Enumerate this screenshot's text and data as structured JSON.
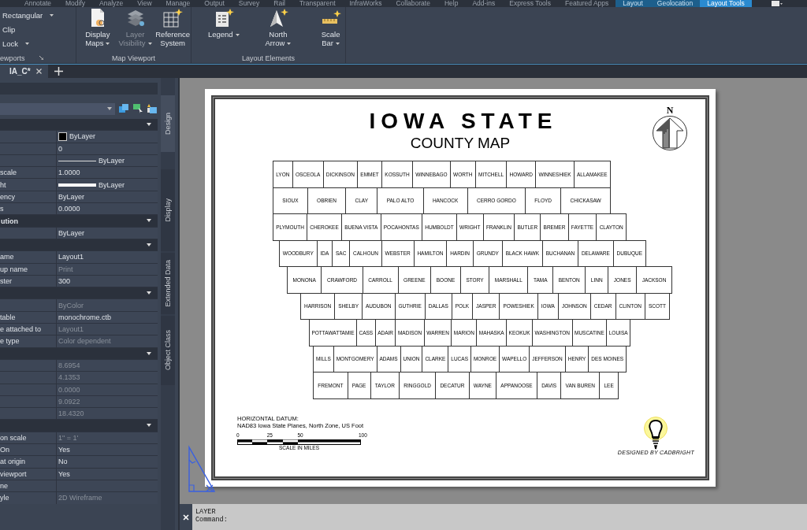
{
  "menu_tabs": [
    {
      "label": "Annotate",
      "kind": "normal",
      "selected": false
    },
    {
      "label": "Modify",
      "kind": "normal",
      "selected": false
    },
    {
      "label": "Analyze",
      "kind": "normal",
      "selected": false
    },
    {
      "label": "View",
      "kind": "normal",
      "selected": false
    },
    {
      "label": "Manage",
      "kind": "normal",
      "selected": false
    },
    {
      "label": "Output",
      "kind": "normal",
      "selected": false
    },
    {
      "label": "Survey",
      "kind": "normal",
      "selected": false
    },
    {
      "label": "Rail",
      "kind": "normal",
      "selected": false
    },
    {
      "label": "Transparent",
      "kind": "normal",
      "selected": false
    },
    {
      "label": "InfraWorks",
      "kind": "normal",
      "selected": false
    },
    {
      "label": "Collaborate",
      "kind": "normal",
      "selected": false
    },
    {
      "label": "Help",
      "kind": "normal",
      "selected": false
    },
    {
      "label": "Add-ins",
      "kind": "normal",
      "selected": false
    },
    {
      "label": "Express Tools",
      "kind": "normal",
      "selected": false
    },
    {
      "label": "Featured Apps",
      "kind": "normal",
      "selected": false
    },
    {
      "label": "Layout",
      "kind": "contextual",
      "selected": false
    },
    {
      "label": "Geolocation",
      "kind": "contextual",
      "selected": false
    },
    {
      "label": "Layout Tools",
      "kind": "contextual",
      "selected": true
    }
  ],
  "ribbon_panels": [
    {
      "title": "ewports",
      "kind": "list",
      "launcher": true,
      "items": [
        {
          "label": "Rectangular",
          "dropdown": true
        },
        {
          "label": "Clip",
          "dropdown": false
        },
        {
          "label": "Lock",
          "dropdown": true
        }
      ]
    },
    {
      "title": "Map Viewport",
      "kind": "large",
      "launcher": false,
      "items": [
        {
          "label": "Display Maps",
          "dropdown": true,
          "disabled": false
        },
        {
          "label": "Layer Visibility",
          "dropdown": true,
          "disabled": true
        },
        {
          "label": "Reference System",
          "dropdown": false,
          "disabled": false
        }
      ]
    },
    {
      "title": "Layout Elements",
      "kind": "large",
      "launcher": false,
      "items": [
        {
          "label": "Legend",
          "dropdown": true,
          "disabled": false
        },
        {
          "label": "North Arrow",
          "dropdown": true,
          "disabled": false
        },
        {
          "label": "Scale Bar",
          "dropdown": true,
          "disabled": false
        }
      ]
    }
  ],
  "file_tabs": [
    {
      "label": "IA_C*",
      "selected": true
    }
  ],
  "properties": [
    {
      "kind": "header"
    },
    {
      "kind": "swatch",
      "value": "ByLayer",
      "disabled": false
    },
    {
      "kind": "row",
      "value": "0",
      "disabled": false
    },
    {
      "kind": "linetype",
      "value": "ByLayer",
      "disabled": false
    },
    {
      "kind": "row",
      "label": "scale",
      "value": "1.0000",
      "disabled": false
    },
    {
      "kind": "lineweight",
      "label": "ht",
      "value": "ByLayer",
      "disabled": false
    },
    {
      "kind": "row",
      "label": "ency",
      "value": "ByLayer",
      "disabled": false
    },
    {
      "kind": "row",
      "label": "s",
      "value": "0.0000",
      "disabled": false
    },
    {
      "kind": "header",
      "title": "ution"
    },
    {
      "kind": "row",
      "value": "ByLayer",
      "disabled": false
    },
    {
      "kind": "header"
    },
    {
      "kind": "row",
      "label": "ame",
      "value": "Layout1",
      "disabled": false
    },
    {
      "kind": "row",
      "label": "up name",
      "value": "Print",
      "disabled": true
    },
    {
      "kind": "row",
      "label": "ster",
      "value": "300",
      "disabled": false
    },
    {
      "kind": "header"
    },
    {
      "kind": "row",
      "value": "ByColor",
      "disabled": true
    },
    {
      "kind": "row",
      "label": "table",
      "value": "monochrome.ctb",
      "disabled": false
    },
    {
      "kind": "row",
      "label": "e attached to",
      "value": "Layout1",
      "disabled": true
    },
    {
      "kind": "row",
      "label": "e type",
      "value": "Color dependent",
      "disabled": true
    },
    {
      "kind": "header"
    },
    {
      "kind": "row",
      "value": "8.6954",
      "disabled": true
    },
    {
      "kind": "row",
      "value": "4.1353",
      "disabled": true
    },
    {
      "kind": "row",
      "value": "0.0000",
      "disabled": true
    },
    {
      "kind": "row",
      "value": "9.0922",
      "disabled": true
    },
    {
      "kind": "row",
      "value": "18.4320",
      "disabled": true
    },
    {
      "kind": "header"
    },
    {
      "kind": "row",
      "label": "on scale",
      "value": "1\" = 1'",
      "disabled": true
    },
    {
      "kind": "row",
      "label": "On",
      "value": "Yes",
      "disabled": false
    },
    {
      "kind": "row",
      "label": "at origin",
      "value": "No",
      "disabled": false
    },
    {
      "kind": "row",
      "label": "viewport",
      "value": "Yes",
      "disabled": false
    },
    {
      "kind": "row",
      "label": "ne"
    },
    {
      "kind": "row",
      "label": "yle",
      "value": "2D Wireframe",
      "disabled": true
    }
  ],
  "side_tabs": [
    {
      "label": "Design",
      "selected": true
    },
    {
      "label": "Display",
      "selected": false
    },
    {
      "label": "Extended Data",
      "selected": false
    },
    {
      "label": "Object Class",
      "selected": false
    }
  ],
  "sheet": {
    "title": "IOWA STATE",
    "subtitle": "COUNTY MAP",
    "north_label": "N",
    "county_rows": [
      [
        "LYON",
        "OSCEOLA",
        "DICKINSON",
        "EMMET",
        "KOSSUTH",
        "WINNEBAGO",
        "WORTH",
        "MITCHELL",
        "HOWARD",
        "WINNESHIEK",
        "ALLAMAKEE"
      ],
      [
        "SIOUX",
        "OBRIEN",
        "CLAY",
        "PALO ALTO",
        "HANCOCK",
        "CERRO GORDO",
        "FLOYD",
        "CHICKASAW"
      ],
      [
        "PLYMOUTH",
        "CHEROKEE",
        "BUENA VISTA",
        "POCAHONTAS",
        "HUMBOLDT",
        "WRIGHT",
        "FRANKLIN",
        "BUTLER",
        "BREMER",
        "FAYETTE",
        "CLAYTON"
      ],
      [
        "WOODBURY",
        "IDA",
        "SAC",
        "CALHOUN",
        "WEBSTER",
        "HAMILTON",
        "HARDIN",
        "GRUNDY",
        "BLACK HAWK",
        "BUCHANAN",
        "DELAWARE",
        "DUBUQUE"
      ],
      [
        "MONONA",
        "CRAWFORD",
        "CARROLL",
        "GREENE",
        "BOONE",
        "STORY",
        "MARSHALL",
        "TAMA",
        "BENTON",
        "LINN",
        "JONES",
        "JACKSON"
      ],
      [
        "HARRISON",
        "SHELBY",
        "AUDUBON",
        "GUTHRIE",
        "DALLAS",
        "POLK",
        "JASPER",
        "POWESHIEK",
        "IOWA",
        "JOHNSON",
        "CEDAR",
        "CLINTON",
        "SCOTT"
      ],
      [
        "POTTAWATTAMIE",
        "CASS",
        "ADAIR",
        "MADISON",
        "WARREN",
        "MARION",
        "MAHASKA",
        "KEOKUK",
        "WASHINGTON",
        "MUSCATINE",
        "LOUISA"
      ],
      [
        "MILLS",
        "MONTGOMERY",
        "ADAMS",
        "UNION",
        "CLARKE",
        "LUCAS",
        "MONROE",
        "WAPELLO",
        "JEFFERSON",
        "HENRY",
        "DES MOINES"
      ],
      [
        "FREMONT",
        "PAGE",
        "TAYLOR",
        "RINGGOLD",
        "DECATUR",
        "WAYNE",
        "APPANOOSE",
        "DAVIS",
        "VAN BUREN",
        "LEE"
      ]
    ],
    "datum_lines": [
      "HORIZONTAL DATUM:",
      "NAD83 Iowa State Planes, North Zone, US Foot"
    ],
    "scale_ticks": [
      "0",
      "25",
      "50",
      "100"
    ],
    "scale_caption": "SCALE IN MILES",
    "credit": "DESIGNED BY CADBRIGHT"
  },
  "command_lines": [
    "LAYER",
    "Command:"
  ]
}
